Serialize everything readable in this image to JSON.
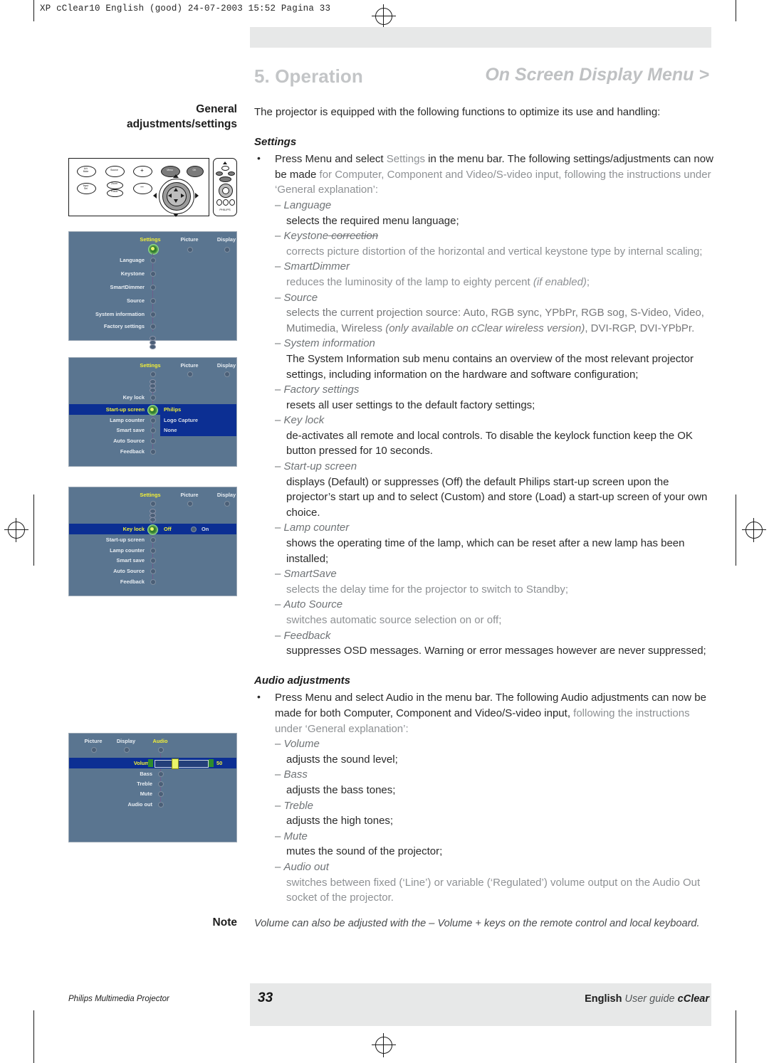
{
  "slug": "XP cClear10 English (good)  24-07-2003  15:52  Pagina 33",
  "header": {
    "chapter": "5. Operation",
    "section": "On Screen Display Menu >"
  },
  "sidebar": {
    "heading_line1": "General",
    "heading_line2": "adjustments/settings"
  },
  "body": {
    "intro": "The projector is equipped with the following functions to optimize its use and handling:",
    "settings_heading": "Settings",
    "settings_bullet_a": "Press Menu and select ",
    "settings_bullet_b": "Settings",
    "settings_bullet_c": " in the menu bar. The following settings/adjustments can now be made ",
    "settings_bullet_d": "for Computer, Component and Video/S-video input, following the instructions under ‘General explanation’:",
    "items": [
      {
        "term": "Language",
        "desc": "selects the required menu language;"
      },
      {
        "term": "Keystone",
        "term_strike": " correction",
        "desc": "corrects picture distortion of the horizontal and vertical keystone type by internal scaling;"
      },
      {
        "term": "SmartDimmer",
        "desc": "reduces the luminosity of the lamp to eighty percent ",
        "desc_italic": "(if enabled)",
        "desc_tail": ";"
      },
      {
        "term": "Source",
        "desc": "selects the current projection source: Auto, RGB sync, YPbPr, RGB sog, S-Video, Video, Mutimedia, Wireless ",
        "desc_italic": "(only available on cClear wireless version)",
        "desc_tail": ", DVI-RGP, DVI-YPbPr."
      },
      {
        "term": "System information",
        "desc": "The System Information sub menu contains an overview of the most relevant projector settings, including information on the hardware and software configuration;"
      },
      {
        "term": "Factory settings",
        "desc": "resets all user settings to the default factory settings;"
      },
      {
        "term": "Key lock",
        "desc": "de-activates all remote and local controls. To disable the keylock function keep the OK button pressed for 10 seconds."
      },
      {
        "term": "Start-up screen",
        "desc": "displays (Default) or suppresses (Off) the default Philips start-up screen upon the projector’s start up and to select (Custom) and store (Load) a start-up screen of your own choice."
      },
      {
        "term": "Lamp counter",
        "desc": "shows the operating time of the lamp, which can be reset after a new lamp has been installed;"
      },
      {
        "term": "SmartSave",
        "desc": "selects the delay time for the projector to switch to Standby;"
      },
      {
        "term": "Auto Source",
        "desc": "switches automatic source selection on or off;"
      },
      {
        "term": "Feedback",
        "desc": "suppresses OSD messages. Warning or error messages however are never suppressed;"
      }
    ],
    "audio_heading": "Audio adjustments",
    "audio_bullet_a": "Press Menu and select Audio in the menu bar.  The following Audio adjustments can now be made for both Computer, Component and Video/S-video input, ",
    "audio_bullet_b": "following the instructions under ‘General explanation’:",
    "audio_items": [
      {
        "term": "Volume",
        "desc": "adjusts the sound level;"
      },
      {
        "term": "Bass",
        "desc": "adjusts the bass tones;"
      },
      {
        "term": "Treble",
        "desc": "adjusts the high tones;"
      },
      {
        "term": "Mute",
        "desc": "mutes the sound of the projector;"
      },
      {
        "term": "Audio out",
        "desc": "switches between fixed (‘Line’) or variable (‘Regulated’) volume output on the Audio Out socket of the projector."
      }
    ]
  },
  "note": {
    "label": "Note",
    "text": "Volume can also be adjusted with the – Volume + keys on the remote control and local keyboard."
  },
  "osd_menus": [
    {
      "name": "settings-menu",
      "tabs": [
        "Settings",
        "Picture",
        "Display"
      ],
      "selected_tab": "Settings",
      "rows": [
        "Language",
        "Keystone",
        "SmartDimmer",
        "Source",
        "System information",
        "Factory settings"
      ],
      "scroll_indicator": true
    },
    {
      "name": "startup-screen-menu",
      "tabs": [
        "Settings",
        "Picture",
        "Display"
      ],
      "selected_tab": "Settings",
      "rows": [
        "Key lock",
        "Start-up screen",
        "Lamp counter",
        "Smart save",
        "Auto Source",
        "Feedback"
      ],
      "highlighted_row": "Start-up screen",
      "submenu": [
        "Philips",
        "Logo Capture",
        "None"
      ],
      "submenu_selected": "Philips"
    },
    {
      "name": "key-lock-menu",
      "tabs": [
        "Settings",
        "Picture",
        "Display"
      ],
      "selected_tab": "Settings",
      "rows": [
        "Key lock",
        "Start-up screen",
        "Lamp counter",
        "Smart save",
        "Auto Source",
        "Feedback"
      ],
      "highlighted_row": "Key lock",
      "options": [
        "Off",
        "On"
      ],
      "option_selected": "Off"
    },
    {
      "name": "audio-menu",
      "tabs": [
        "Picture",
        "Display",
        "Audio"
      ],
      "selected_tab": "Audio",
      "rows": [
        "Volume",
        "Bass",
        "Treble",
        "Mute",
        "Audio out"
      ],
      "highlighted_row": "Volume",
      "slider_value": "50"
    }
  ],
  "control_panel": {
    "buttons": [
      "A/V Mute",
      "Source",
      "+",
      "Input Sel",
      "Zoom",
      "Focus",
      "–",
      "Menu",
      "OK"
    ]
  },
  "footer": {
    "left": "Philips Multimedia Projector",
    "page": "33",
    "right_bold": "English",
    "right_italic": "User guide",
    "right_product": "cClear"
  }
}
